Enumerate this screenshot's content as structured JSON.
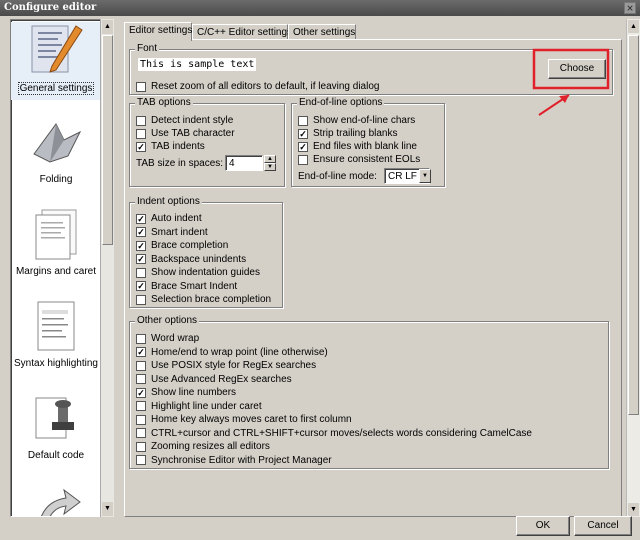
{
  "window": {
    "title": "Configure editor",
    "close_glyph": "×"
  },
  "sidebar": {
    "items": [
      {
        "label": "General settings",
        "icon": "pen-and-paper-icon",
        "selected": true
      },
      {
        "label": "Folding",
        "icon": "origami-bird-icon"
      },
      {
        "label": "Margins and caret",
        "icon": "pages-icon"
      },
      {
        "label": "Syntax highlighting",
        "icon": "highlight-page-icon"
      },
      {
        "label": "Default code",
        "icon": "stamp-icon"
      },
      {
        "label": "",
        "icon": "arrow-icon"
      }
    ]
  },
  "tabs": [
    {
      "label": "Editor settings",
      "active": true
    },
    {
      "label": "C/C++ Editor settings"
    },
    {
      "label": "Other settings"
    }
  ],
  "font": {
    "group_title": "Font",
    "sample_text": "This is sample text",
    "choose_label": "Choose",
    "reset_zoom_label": "Reset zoom of all editors to default, if leaving dialog",
    "reset_zoom_checked": false
  },
  "tab_options": {
    "title": "TAB options",
    "items": [
      {
        "label": "Detect indent style",
        "checked": false
      },
      {
        "label": "Use TAB character",
        "checked": false
      },
      {
        "label": "TAB indents",
        "checked": true
      }
    ],
    "size_label": "TAB size in spaces:",
    "size_value": "4",
    "spin_up": "▲",
    "spin_down": "▼"
  },
  "eol_options": {
    "title": "End-of-line options",
    "items": [
      {
        "label": "Show end-of-line chars",
        "checked": false
      },
      {
        "label": "Strip trailing blanks",
        "checked": true
      },
      {
        "label": "End files with blank line",
        "checked": true
      },
      {
        "label": "Ensure consistent EOLs",
        "checked": false
      }
    ],
    "mode_label": "End-of-line mode:",
    "mode_value": "CR LF",
    "dropdown_glyph": "▼"
  },
  "indent_options": {
    "title": "Indent options",
    "items": [
      {
        "label": "Auto indent",
        "checked": true
      },
      {
        "label": "Smart indent",
        "checked": true
      },
      {
        "label": "Brace completion",
        "checked": true
      },
      {
        "label": "Backspace unindents",
        "checked": true
      },
      {
        "label": "Show indentation guides",
        "checked": false
      },
      {
        "label": "Brace Smart Indent",
        "checked": true
      },
      {
        "label": "Selection brace completion",
        "checked": false
      }
    ]
  },
  "other_options": {
    "title": "Other options",
    "items": [
      {
        "label": "Word wrap",
        "checked": false
      },
      {
        "label": "Home/end to wrap point (line otherwise)",
        "checked": true
      },
      {
        "label": "Use POSIX style for RegEx searches",
        "checked": false
      },
      {
        "label": "Use Advanced RegEx searches",
        "checked": false
      },
      {
        "label": "Show line numbers",
        "checked": true
      },
      {
        "label": "Highlight line under caret",
        "checked": false
      },
      {
        "label": "Home key always moves caret to first column",
        "checked": false
      },
      {
        "label": "CTRL+cursor and CTRL+SHIFT+cursor moves/selects words considering CamelCase",
        "checked": false
      },
      {
        "label": "Zooming resizes all editors",
        "checked": false
      },
      {
        "label": "Synchronise Editor with Project Manager",
        "checked": false
      }
    ]
  },
  "footer": {
    "ok_label": "OK",
    "cancel_label": "Cancel"
  },
  "scroll_glyphs": {
    "up": "▲",
    "down": "▼"
  },
  "annotation": {
    "highlight_color": "#e0202a"
  }
}
